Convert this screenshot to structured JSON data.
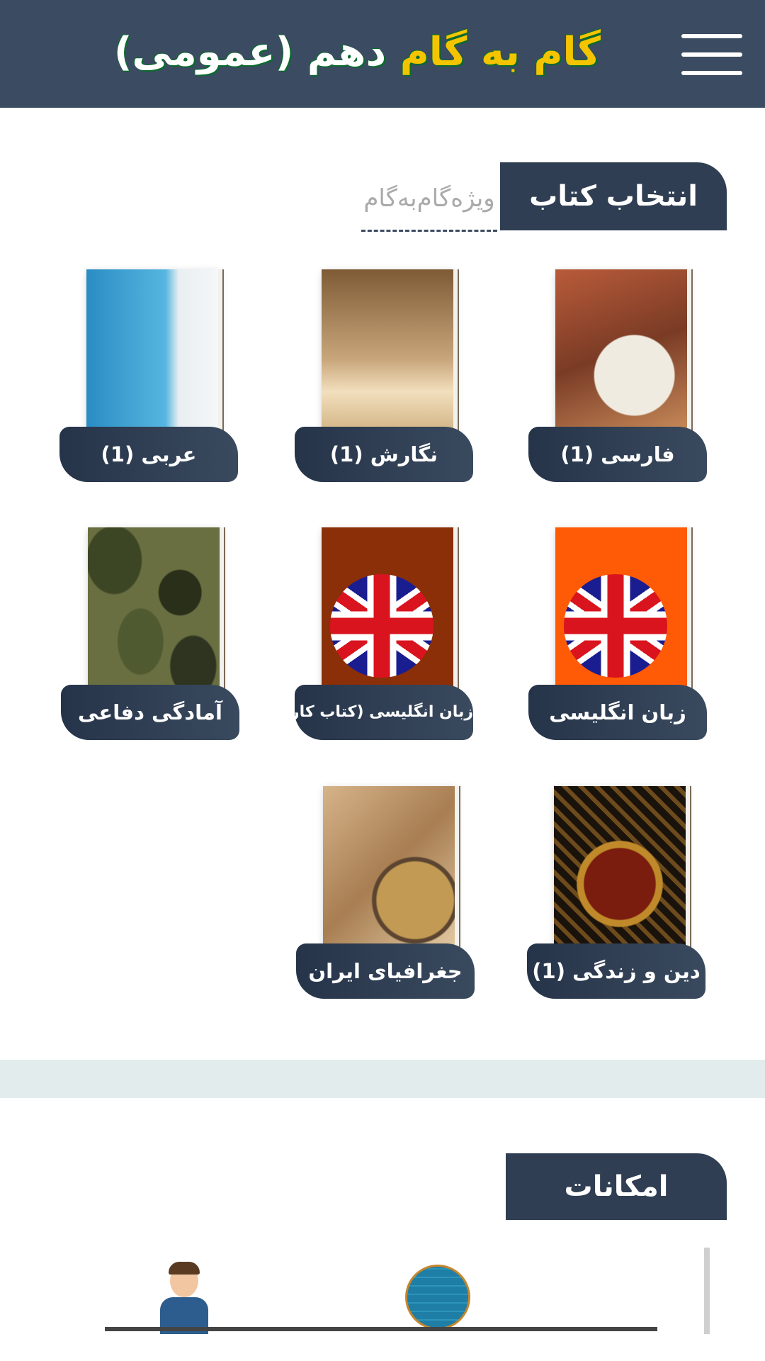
{
  "header": {
    "title_part1": "گام به گام",
    "title_part2": "دهم (عمومی)",
    "menu_icon": "hamburger-menu-icon"
  },
  "books_section": {
    "tab_label": "انتخاب کتاب",
    "sub_label": "ویژه‌گام‌به‌گام",
    "books": [
      {
        "label": "فارسی (1)"
      },
      {
        "label": "نگارش (1)"
      },
      {
        "label": "عربی (1)"
      },
      {
        "label": "زبان انگلیسی"
      },
      {
        "label": "زبان انگلیسی (کتاب کار)"
      },
      {
        "label": "آمادگی دفاعی"
      },
      {
        "label": "دین و زندگی (1)"
      },
      {
        "label": "جغرافیای ایران"
      }
    ]
  },
  "features_section": {
    "tab_label": "امکانات"
  },
  "colors": {
    "header_bg": "#3b4b61",
    "title_yellow": "#f5c400",
    "tab_bg": "#2f3e52",
    "divider_bg": "#e2eced"
  }
}
